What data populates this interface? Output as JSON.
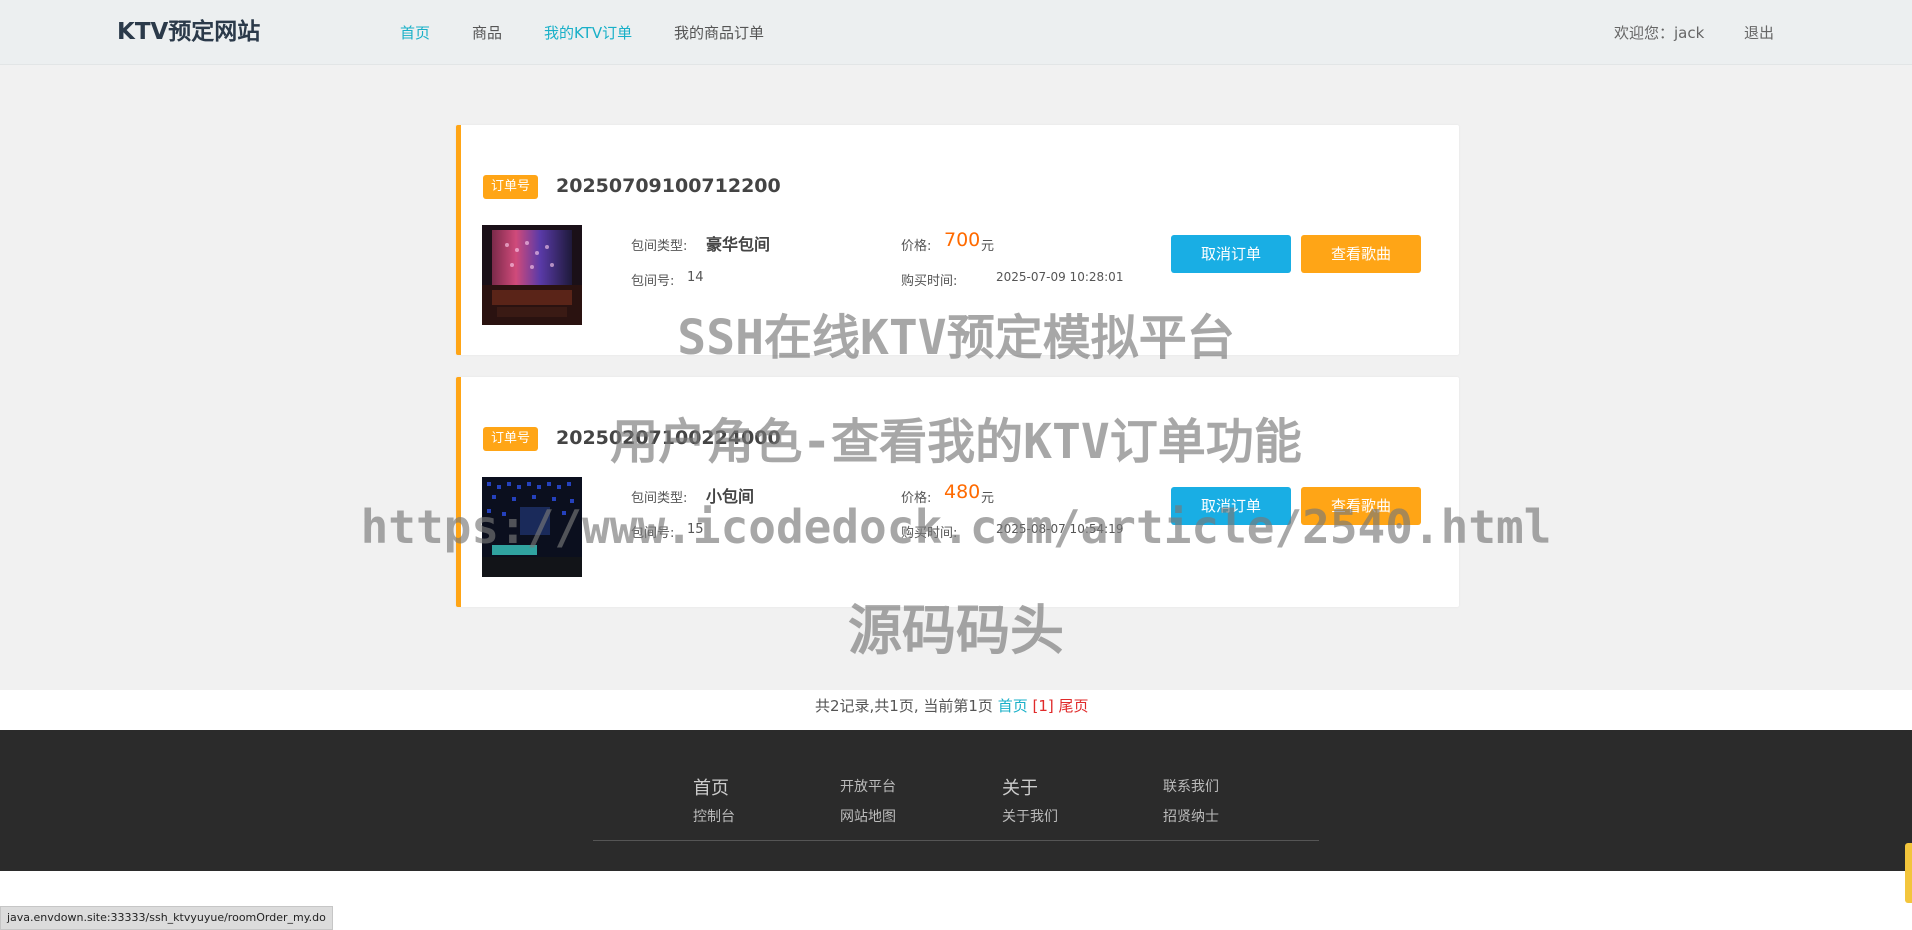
{
  "header": {
    "brand": "KTV预定网站",
    "nav": [
      "首页",
      "商品",
      "我的KTV订单",
      "我的商品订单"
    ],
    "welcome": "欢迎您：jack",
    "logout": "退出"
  },
  "orders": [
    {
      "badge": "订单号",
      "order_no": "20250709100712200",
      "room_type_label": "包间类型:",
      "room_type": "豪华包间",
      "room_no_label": "包间号:",
      "room_no": "14",
      "price_label": "价格:",
      "price": "700",
      "price_unit": "元",
      "time_label": "购买时间:",
      "time": "2025-07-09 10:28:01",
      "cancel": "取消订单",
      "songs": "查看歌曲"
    },
    {
      "badge": "订单号",
      "order_no": "20250207100224000",
      "room_type_label": "包间类型:",
      "room_type": "小包间",
      "room_no_label": "包间号:",
      "room_no": "15",
      "price_label": "价格:",
      "price": "480",
      "price_unit": "元",
      "time_label": "购买时间:",
      "time": "2025-08-07 10:54:19",
      "cancel": "取消订单",
      "songs": "查看歌曲"
    }
  ],
  "pager": {
    "summary": "共2记录,共1页, 当前第1页",
    "home": "首页",
    "current": "[1]",
    "last": "尾页"
  },
  "footer": {
    "col1": [
      "首页",
      "控制台"
    ],
    "col2": [
      "开放平台",
      "网站地图"
    ],
    "col3": [
      "关于",
      "关于我们"
    ],
    "col4": [
      "联系我们",
      "招贤纳士"
    ]
  },
  "watermark": {
    "line1": "SSH在线KTV预定模拟平台",
    "line2": "用户角色-查看我的KTV订单功能",
    "line3": "https://www.icodedock.com/article/2540.html",
    "line4": "源码码头"
  },
  "statusbar": "java.envdown.site:33333/ssh_ktvyuyue/roomOrder_my.do",
  "colors": {
    "accent_orange": "#ffa516",
    "accent_blue": "#19aee4",
    "nav_active": "#19b0c8",
    "footer_bg": "#2b2b2b"
  }
}
